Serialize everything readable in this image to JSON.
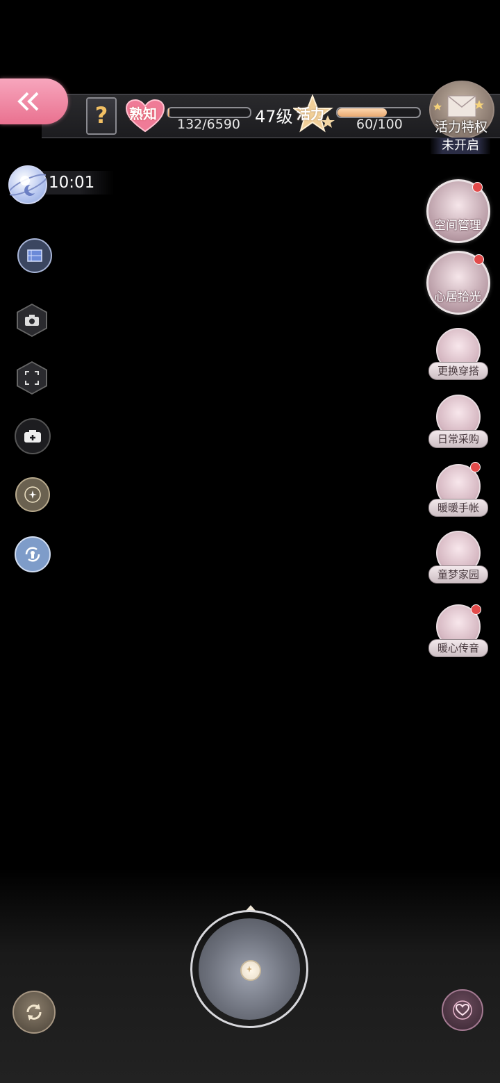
{
  "top_bar": {
    "familiarity_label": "熟知",
    "familiarity_progress": "132/6590",
    "familiarity_fraction": 0.02,
    "level": "47级",
    "vitality_label": "活力",
    "vitality_progress": "60/100",
    "vitality_fraction": 0.6,
    "vip_label": "活力特权",
    "vip_status": "未开启",
    "help_glyph": "?"
  },
  "clock": {
    "time": "10:01"
  },
  "right_menu": [
    {
      "label": "空间管理",
      "badge": true
    },
    {
      "label": "心居拾光",
      "badge": true
    },
    {
      "label": "更换穿搭",
      "badge": false
    },
    {
      "label": "日常采购",
      "badge": false
    },
    {
      "label": "暖暖手帐",
      "badge": true
    },
    {
      "label": "童梦家园",
      "badge": false
    },
    {
      "label": "暖心传音",
      "badge": true
    }
  ],
  "left_tools": [
    "blueprint-icon",
    "camera-icon",
    "fullscreen-icon",
    "add-photo-icon",
    "compass-icon",
    "refresh-lock-icon"
  ],
  "colors": {
    "accent_pink": "#ef7b97",
    "badge_red": "#e24a4a",
    "bar_fill": "#e8a870"
  }
}
